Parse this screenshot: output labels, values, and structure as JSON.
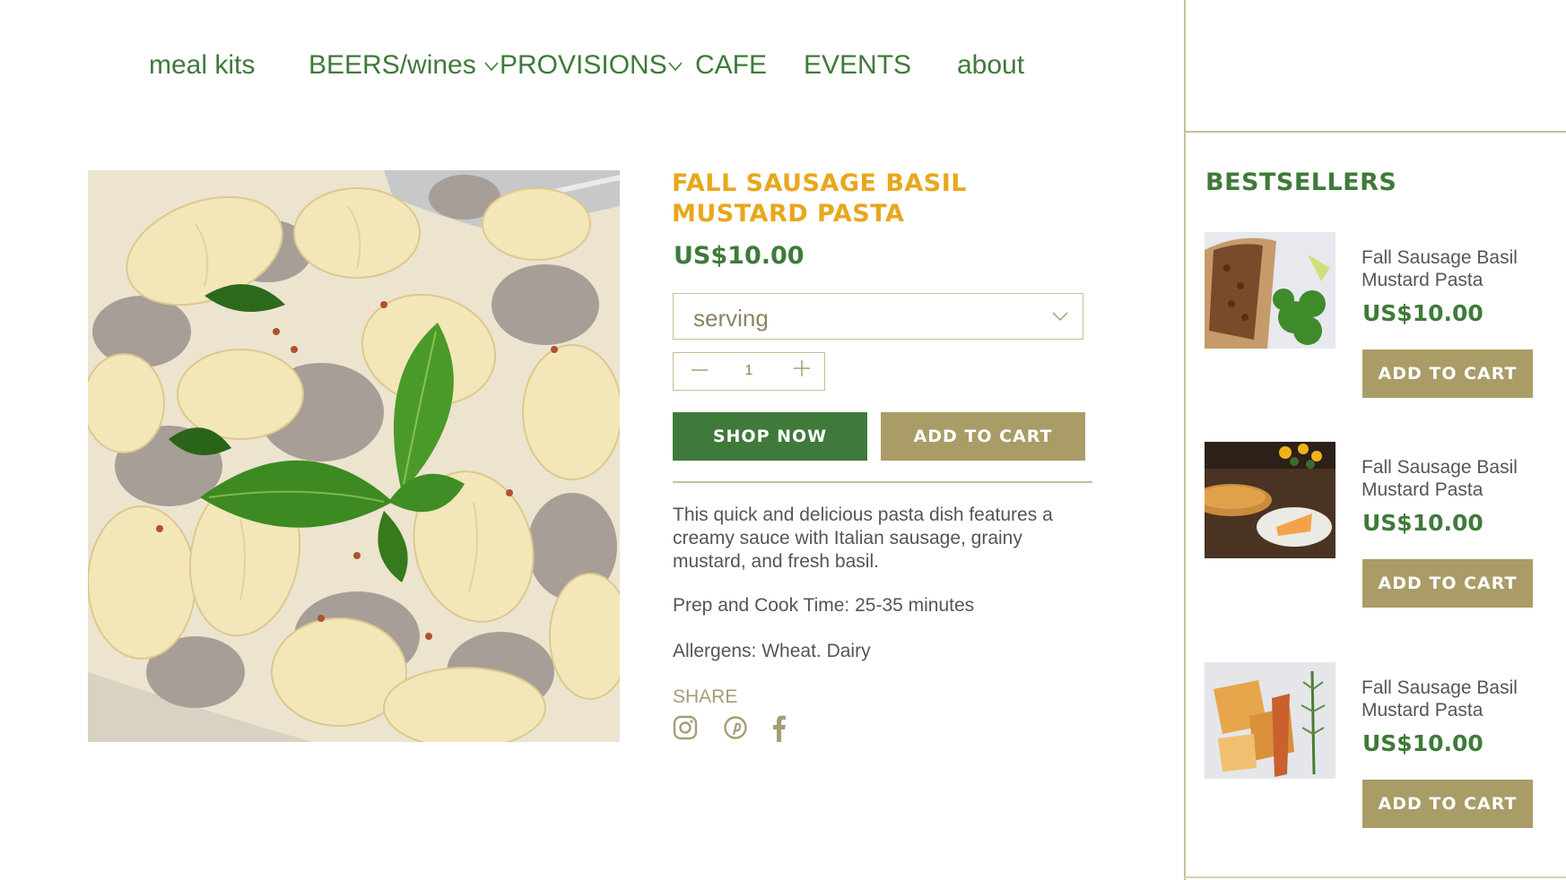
{
  "nav": {
    "items": [
      {
        "label": "meal kits",
        "has_dropdown": false
      },
      {
        "label": "BEERS/wines",
        "has_dropdown": true
      },
      {
        "label": "PROVISIONS",
        "has_dropdown": true
      },
      {
        "label": "CAFE",
        "has_dropdown": false
      },
      {
        "label": "EVENTS",
        "has_dropdown": false
      },
      {
        "label": "about",
        "has_dropdown": false
      }
    ]
  },
  "product": {
    "image": "pasta-shells-sausage-basil",
    "title": "FALL SAUSAGE BASIL MUSTARD PASTA",
    "price": "US$10.00",
    "serving_select": {
      "value": "serving"
    },
    "quantity": "1",
    "shop_now_label": "SHOP NOW",
    "add_to_cart_label": "ADD TO CART",
    "description": "This quick and delicious pasta dish features a creamy sauce with Italian sausage, grainy mustard, and fresh basil.",
    "prep_time": "Prep and Cook Time: 25-35 minutes",
    "allergens": "Allergens: Wheat. Dairy",
    "share_label": "SHARE",
    "share_icons": [
      "instagram-icon",
      "pinterest-icon",
      "facebook-icon"
    ]
  },
  "bestsellers": {
    "title": "BESTSELLERS",
    "items": [
      {
        "name": "Fall Sausage Basil Mustard Pasta",
        "price": "US$10.00",
        "button": "ADD TO CART",
        "image": "meatloaf-broccoli"
      },
      {
        "name": "Fall Sausage Basil Mustard Pasta",
        "price": "US$10.00",
        "button": "ADD TO CART",
        "image": "pie-slice"
      },
      {
        "name": "Fall Sausage Basil Mustard Pasta",
        "price": "US$10.00",
        "button": "ADD TO CART",
        "image": "pastry-rosemary"
      }
    ]
  },
  "colors": {
    "green": "#3f7a3a",
    "gold": "#e8a71c",
    "tan": "#a99c67",
    "divider": "#c9bf97"
  }
}
